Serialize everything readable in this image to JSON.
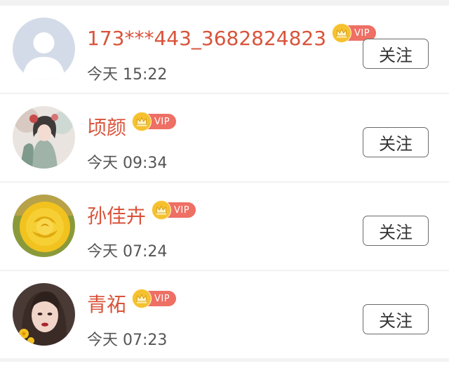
{
  "followers": [
    {
      "name": "173***443_3682824823",
      "vip_label": "VIP",
      "time": "今天 15:22",
      "follow_label": "关注",
      "avatar": "default-avatar"
    },
    {
      "name": "顷颜",
      "vip_label": "VIP",
      "time": "今天 09:34",
      "follow_label": "关注",
      "avatar": "illustrated-girl-avatar"
    },
    {
      "name": "孙佳卉",
      "vip_label": "VIP",
      "time": "今天 07:24",
      "follow_label": "关注",
      "avatar": "yellow-rose-avatar"
    },
    {
      "name": "青祏",
      "vip_label": "VIP",
      "time": "今天 07:23",
      "follow_label": "关注",
      "avatar": "portrait-woman-avatar"
    }
  ],
  "colors": {
    "name": "#d9533a",
    "vip_badge": "#ee6f64",
    "vip_crown": "#f6c12f",
    "divider": "#f2f2f2"
  }
}
